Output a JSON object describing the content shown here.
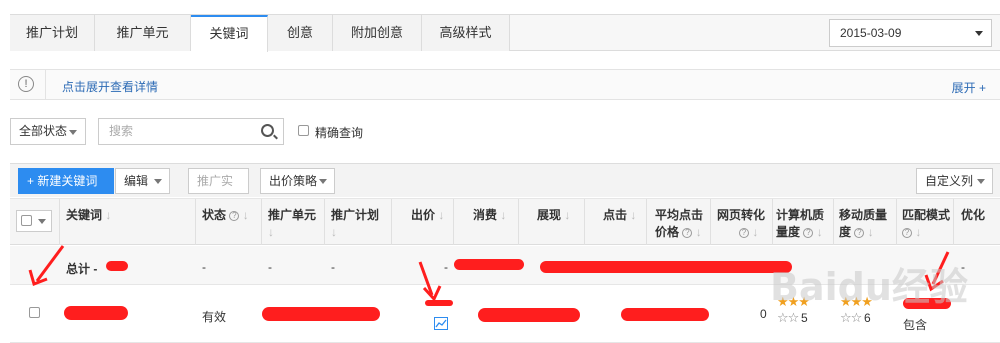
{
  "tabs": [
    "推广计划",
    "推广单元",
    "关键词",
    "创意",
    "附加创意",
    "高级样式"
  ],
  "date": "2015-03-09",
  "info": {
    "text": "点击展开查看详情",
    "expand": "展开 +"
  },
  "filters": {
    "status": "全部状态",
    "search_placeholder": "搜索",
    "exact": "精确查询"
  },
  "toolbar": {
    "new_keyword": "+ 新建关键词",
    "edit": "编辑",
    "promote": "推广实况",
    "bid_strategy": "出价策略",
    "custom_cols": "自定义列"
  },
  "columns": {
    "keyword": "关键词",
    "status": "状态",
    "unit": "推广单元",
    "plan": "推广计划",
    "bid": "出价",
    "cost": "消费",
    "impressions": "展现",
    "clicks": "点击",
    "avg_price_1": "平均点击",
    "avg_price_2": "价格",
    "web_conv_1": "网页转化",
    "pc_q_1": "计算机质",
    "pc_q_2": "量度",
    "mob_q_1": "移动质量",
    "mob_q_2": "度",
    "match": "匹配模式",
    "optimize": "优化"
  },
  "total_row": {
    "label": "总计 -",
    "status": "-",
    "unit": "-",
    "plan": "-",
    "bid": "-",
    "optimize": "-"
  },
  "row1": {
    "status": "有效",
    "web_conv": "0",
    "pc_quality": "5",
    "mobile_quality": "6",
    "match": "包含"
  },
  "watermark": "Baidu经验"
}
